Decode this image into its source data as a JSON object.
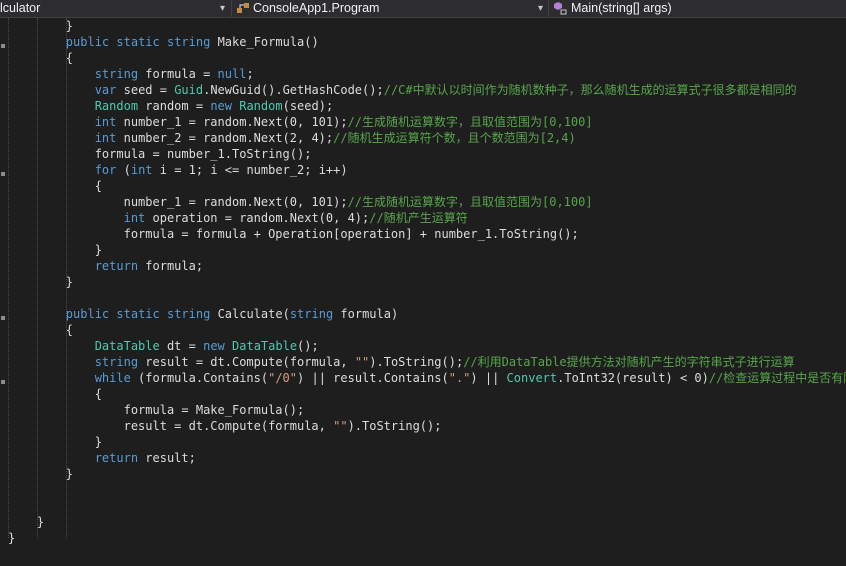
{
  "navbar": {
    "project": "lculator",
    "class": "ConsoleApp1.Program",
    "member": "Main(string[] args)",
    "dropdown_glyph": "▾"
  },
  "lines": [
    [
      [
        "tx",
        "        }"
      ]
    ],
    [
      [
        "tx",
        "        "
      ],
      [
        "kw",
        "public"
      ],
      [
        "tx",
        " "
      ],
      [
        "kw",
        "static"
      ],
      [
        "tx",
        " "
      ],
      [
        "kw",
        "string"
      ],
      [
        "tx",
        " Make_Formula()"
      ]
    ],
    [
      [
        "tx",
        "        {"
      ]
    ],
    [
      [
        "tx",
        "            "
      ],
      [
        "kw",
        "string"
      ],
      [
        "tx",
        " formula = "
      ],
      [
        "kw",
        "null"
      ],
      [
        "tx",
        ";"
      ]
    ],
    [
      [
        "tx",
        "            "
      ],
      [
        "kw",
        "var"
      ],
      [
        "tx",
        " seed = "
      ],
      [
        "ty",
        "Guid"
      ],
      [
        "tx",
        ".NewGuid().GetHashCode();"
      ],
      [
        "cm",
        "//C#中默认以时间作为随机数种子，那么随机生成的运算式子很多都是相同的"
      ]
    ],
    [
      [
        "tx",
        "            "
      ],
      [
        "ty",
        "Random"
      ],
      [
        "tx",
        " random = "
      ],
      [
        "kw",
        "new"
      ],
      [
        "tx",
        " "
      ],
      [
        "ty",
        "Random"
      ],
      [
        "tx",
        "(seed);"
      ]
    ],
    [
      [
        "tx",
        "            "
      ],
      [
        "kw",
        "int"
      ],
      [
        "tx",
        " number_1 = random.Next(0, 101);"
      ],
      [
        "cm",
        "//生成随机运算数字，且取值范围为[0,100]"
      ]
    ],
    [
      [
        "tx",
        "            "
      ],
      [
        "kw",
        "int"
      ],
      [
        "tx",
        " number_2 = random.Next(2, 4);"
      ],
      [
        "cm",
        "//随机生成运算符个数，且个数范围为[2,4)"
      ]
    ],
    [
      [
        "tx",
        "            formula = number_1.ToString();"
      ]
    ],
    [
      [
        "tx",
        "            "
      ],
      [
        "kw",
        "for"
      ],
      [
        "tx",
        " ("
      ],
      [
        "kw",
        "int"
      ],
      [
        "tx",
        " i = 1; i <= number_2; i++)"
      ]
    ],
    [
      [
        "tx",
        "            {"
      ]
    ],
    [
      [
        "tx",
        "                number_1 = random.Next(0, 101);"
      ],
      [
        "cm",
        "//生成随机运算数字，且取值范围为[0,100]"
      ]
    ],
    [
      [
        "tx",
        "                "
      ],
      [
        "kw",
        "int"
      ],
      [
        "tx",
        " operation = random.Next(0, 4);"
      ],
      [
        "cm",
        "//随机产生运算符"
      ]
    ],
    [
      [
        "tx",
        "                formula = formula + Operation[operation] + number_1.ToString();"
      ]
    ],
    [
      [
        "tx",
        "            }"
      ]
    ],
    [
      [
        "tx",
        "            "
      ],
      [
        "kw",
        "return"
      ],
      [
        "tx",
        " formula;"
      ]
    ],
    [
      [
        "tx",
        "        }"
      ]
    ],
    [
      [
        "tx",
        ""
      ]
    ],
    [
      [
        "tx",
        "        "
      ],
      [
        "kw",
        "public"
      ],
      [
        "tx",
        " "
      ],
      [
        "kw",
        "static"
      ],
      [
        "tx",
        " "
      ],
      [
        "kw",
        "string"
      ],
      [
        "tx",
        " Calculate("
      ],
      [
        "kw",
        "string"
      ],
      [
        "tx",
        " formula)"
      ]
    ],
    [
      [
        "tx",
        "        {"
      ]
    ],
    [
      [
        "tx",
        "            "
      ],
      [
        "ty",
        "DataTable"
      ],
      [
        "tx",
        " dt = "
      ],
      [
        "kw",
        "new"
      ],
      [
        "tx",
        " "
      ],
      [
        "ty",
        "DataTable"
      ],
      [
        "tx",
        "();"
      ]
    ],
    [
      [
        "tx",
        "            "
      ],
      [
        "kw",
        "string"
      ],
      [
        "tx",
        " result = dt.Compute(formula, "
      ],
      [
        "st",
        "\"\""
      ],
      [
        "tx",
        ").ToString();"
      ],
      [
        "cm",
        "//利用DataTable提供方法对随机产生的字符串式子进行运算"
      ]
    ],
    [
      [
        "tx",
        "            "
      ],
      [
        "kw",
        "while"
      ],
      [
        "tx",
        " (formula.Contains("
      ],
      [
        "st",
        "\"/0\""
      ],
      [
        "tx",
        ") || result.Contains("
      ],
      [
        "st",
        "\".\""
      ],
      [
        "tx",
        ") || "
      ],
      [
        "ty",
        "Convert"
      ],
      [
        "tx",
        ".ToInt32(result) < 0)"
      ],
      [
        "cm",
        "//检查运算过程中是否有除零"
      ]
    ],
    [
      [
        "tx",
        "            {"
      ]
    ],
    [
      [
        "tx",
        "                formula = Make_Formula();"
      ]
    ],
    [
      [
        "tx",
        "                result = dt.Compute(formula, "
      ],
      [
        "st",
        "\"\""
      ],
      [
        "tx",
        ").ToString();"
      ]
    ],
    [
      [
        "tx",
        "            }"
      ]
    ],
    [
      [
        "tx",
        "            "
      ],
      [
        "kw",
        "return"
      ],
      [
        "tx",
        " result;"
      ]
    ],
    [
      [
        "tx",
        "        }"
      ]
    ],
    [
      [
        "tx",
        ""
      ]
    ],
    [
      [
        "tx",
        ""
      ]
    ],
    [
      [
        "tx",
        "    }"
      ]
    ],
    [
      [
        "tx",
        "}"
      ]
    ]
  ]
}
